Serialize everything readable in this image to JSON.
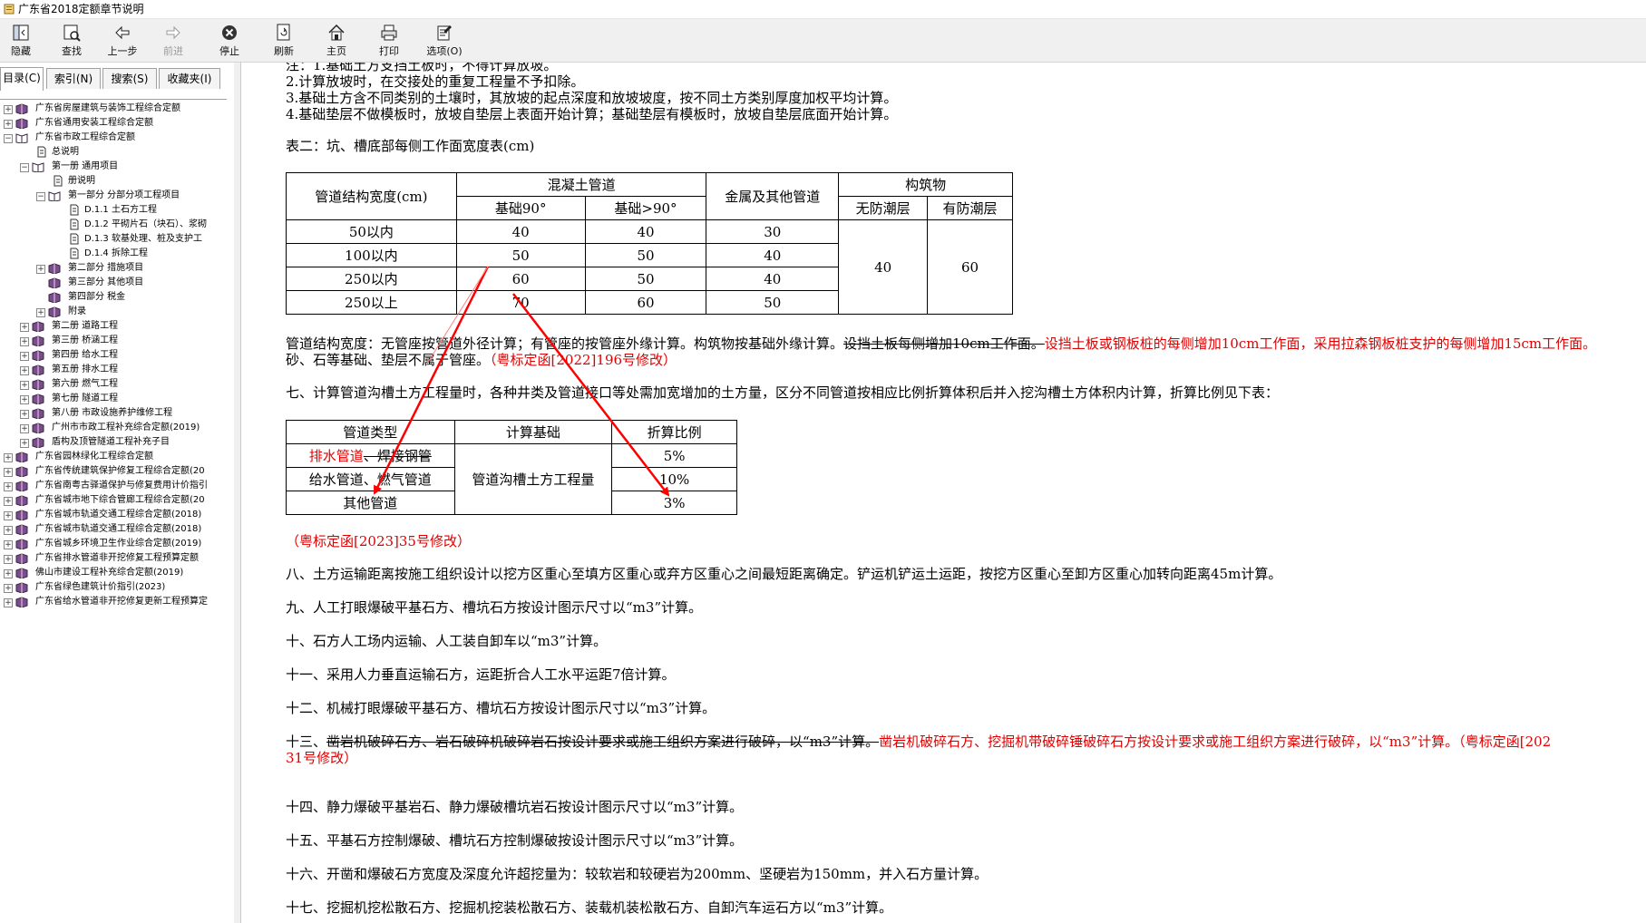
{
  "window": {
    "title": "广东省2018定额章节说明"
  },
  "toolbar": {
    "hide": "隐藏",
    "find": "查找",
    "back": "上一步",
    "forward": "前进",
    "stop": "停止",
    "refresh": "刷新",
    "home": "主页",
    "print": "打印",
    "options": "选项(O)"
  },
  "tabs": [
    "目录(C)",
    "索引(N)",
    "搜索(S)",
    "收藏夹(I)"
  ],
  "tree": [
    "广东省房屋建筑与装饰工程综合定额",
    "广东省通用安装工程综合定额",
    "广东省市政工程综合定额",
    "总说明",
    "第一册  通用项目",
    "册说明",
    "第一部分  分部分项工程项目",
    "D.1.1  土石方工程",
    "D.1.2  平砌片石（块石）、浆砌",
    "D.1.3  软基处理、桩及支护工",
    "D.1.4  拆除工程",
    "第二部分  措施项目",
    "第三部分  其他项目",
    "第四部分  税金",
    "附录",
    "第二册  道路工程",
    "第三册  桥涵工程",
    "第四册  给水工程",
    "第五册  排水工程",
    "第六册  燃气工程",
    "第七册  隧道工程",
    "第八册  市政设施养护维修工程",
    "广州市市政工程补充综合定额(2019)",
    "盾构及顶管隧道工程补充子目",
    "广东省园林绿化工程综合定额",
    "广东省传统建筑保护修复工程综合定额(20",
    "广东省南粤古驿道保护与修复费用计价指引",
    "广东省城市地下综合管廊工程综合定额(20",
    "广东省城市轨道交通工程综合定额(2018)",
    "广东省城市轨道交通工程综合定额(2018)",
    "广东省城乡环境卫生作业综合定额(2019)",
    "广东省排水管道非开挖修复工程预算定额",
    "佛山市建设工程补充综合定额(2019)",
    "广东省绿色建筑计价指引(2023)",
    "广东省给水管道非开挖修复更新工程预算定"
  ],
  "content": {
    "note1": "注：1.基础土方支挡土板时，不得计算放坡。",
    "note2": "2.计算放坡时，在交接处的重复工程量不予扣除。",
    "note3": "3.基础土方含不同类别的土壤时，其放坡的起点深度和放坡坡度，按不同土方类别厚度加权平均计算。",
    "note4": "4.基础垫层不做模板时，放坡自垫层上表面开始计算；基础垫层有模板时，放坡自垫层底面开始计算。",
    "table2_title": "表二：坑、槽底部每侧工作面宽度表(cm)",
    "t2_h_width": "管道结构宽度(cm)",
    "t2_h_concrete": "混凝土管道",
    "t2_h_base90": "基础90°",
    "t2_h_base_gt90": "基础>90°",
    "t2_h_metal": "金属及其他管道",
    "t2_h_structure": "构筑物",
    "t2_h_nomoist": "无防潮层",
    "t2_h_moist": "有防潮层",
    "t2_rows": [
      [
        "50以内",
        "40",
        "40",
        "30"
      ],
      [
        "100以内",
        "50",
        "50",
        "40"
      ],
      [
        "250以内",
        "60",
        "50",
        "40"
      ],
      [
        "250以上",
        "70",
        "60",
        "50"
      ]
    ],
    "t2_struct_nomoist": "40",
    "t2_struct_moist": "60",
    "para_width_a": "管道结构宽度：无管座按管道外径计算；有管座的按管座外缘计算。构筑物按基础外缘计算。",
    "para_width_strike": "设挡土板每侧增加10cm工作面。",
    "para_width_red": "设挡土板或钢板桩的每侧增加10cm工作面，采用拉森钢板桩支护的每侧增加15cm工作面。",
    "para_width_b": "砂、石等基础、垫层不属于管座。",
    "para_width_note": "（粤标定函[2022]196号修改）",
    "para7": "七、计算管道沟槽土方工程量时，各种井类及管道接口等处需加宽增加的土方量，区分不同管道按相应比例折算体积后并入挖沟槽土方体积内计算，折算比例见下表：",
    "t3_h_type": "管道类型",
    "t3_h_base": "计算基础",
    "t3_h_ratio": "折算比例",
    "t3_r1_red": "排水管道",
    "t3_r1_strike": "、焊接钢管",
    "t3_r1_ratio": "5%",
    "t3_r2_type": "给水管道、燃气管道",
    "t3_r2_ratio": "10%",
    "t3_r3_type": "其他管道",
    "t3_r3_ratio": "3%",
    "t3_base_value": "管道沟槽土方工程量",
    "note_2023": "（粤标定函[2023]35号修改）",
    "para8": "八、土方运输距离按施工组织设计以挖方区重心至填方区重心或弃方区重心之间最短距离确定。铲运机铲运土运距，按挖方区重心至卸方区重心加转向距离45m计算。",
    "para9": "九、人工打眼爆破平基石方、槽坑石方按设计图示尺寸以“m3”计算。",
    "para10": "十、石方人工场内运输、人工装自卸车以“m3”计算。",
    "para11": "十一、采用人力垂直运输石方，运距折合人工水平运距7倍计算。",
    "para12": "十二、机械打眼爆破平基石方、槽坑石方按设计图示尺寸以“m3”计算。",
    "para13_prefix": "十三、",
    "para13_strike": "凿岩机破碎石方、岩石破碎机破碎岩石按设计要求或施工组织方案进行破碎，以“m3”计算。",
    "para13_red": "凿岩机破碎石方、挖掘机带破碎锤破碎石方按设计要求或施工组织方案进行破碎，以“m3”计算。（粤标定函[202",
    "para13_red2": "31号修改）",
    "para14": "十四、静力爆破平基岩石、静力爆破槽坑岩石按设计图示尺寸以“m3”计算。",
    "para15": "十五、平基石方控制爆破、槽坑石方控制爆破按设计图示尺寸以“m3”计算。",
    "para16": "十六、开凿和爆破石方宽度及深度允许超挖量为：较软岩和较硬岩为200mm、坚硬岩为150mm，并入石方量计算。",
    "para17": "十七、挖掘机挖松散石方、挖掘机挖装松散石方、装载机装松散石方、自卸汽车运石方以“m3”计算。"
  },
  "colors": {
    "annotation": "#e00000",
    "book": "#7a4d8a",
    "folder": "#caa000"
  }
}
